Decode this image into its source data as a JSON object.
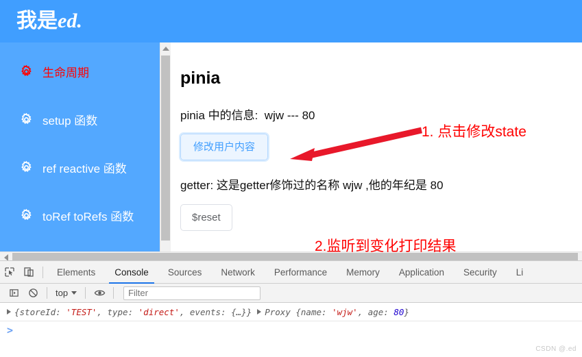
{
  "header": {
    "title_cn": "我是",
    "title_en": "ed."
  },
  "sidebar": {
    "items": [
      {
        "label": "生命周期",
        "icon": "gear-icon",
        "active": true
      },
      {
        "label": "setup 函数",
        "icon": "gear-icon",
        "active": false
      },
      {
        "label": "ref reactive 函数",
        "icon": "gear-icon",
        "active": false
      },
      {
        "label": "toRef toRefs 函数",
        "icon": "gear-icon",
        "active": false
      }
    ]
  },
  "main": {
    "heading": "pinia",
    "info_line": "pinia 中的信息:  wjw --- 80",
    "modify_button": "修改用户内容",
    "getter_line": "getter: 这是getter修饰过的名称 wjw ,他的年纪是 80",
    "reset_button": "$reset"
  },
  "annotations": [
    {
      "text": "1. 点击修改state",
      "color": "#ff0000"
    },
    {
      "text": "2.监听到变化打印结果",
      "color": "#ff0000"
    }
  ],
  "devtools": {
    "tabs": [
      {
        "label": "Elements",
        "active": false
      },
      {
        "label": "Console",
        "active": true
      },
      {
        "label": "Sources",
        "active": false
      },
      {
        "label": "Network",
        "active": false
      },
      {
        "label": "Performance",
        "active": false
      },
      {
        "label": "Memory",
        "active": false
      },
      {
        "label": "Application",
        "active": false
      },
      {
        "label": "Security",
        "active": false
      },
      {
        "label": "Li",
        "active": false
      }
    ],
    "toolbar": {
      "context_label": "top",
      "filter_placeholder": "Filter",
      "filter_value": ""
    },
    "console_rows": [
      {
        "segments": [
          {
            "text": "{storeId: ",
            "style": "gray"
          },
          {
            "text": "'TEST'",
            "style": "red"
          },
          {
            "text": ", type: ",
            "style": "gray"
          },
          {
            "text": "'direct'",
            "style": "red"
          },
          {
            "text": ", events: {…}}",
            "style": "gray"
          }
        ],
        "second": [
          {
            "text": "Proxy {name: ",
            "style": "gray"
          },
          {
            "text": "'wjw'",
            "style": "red"
          },
          {
            "text": ", age: ",
            "style": "gray"
          },
          {
            "text": "80",
            "style": "blue"
          },
          {
            "text": "}",
            "style": "gray"
          }
        ]
      }
    ],
    "prompt": ">"
  },
  "watermark": "CSDN @.ed",
  "colors": {
    "brand_blue": "#409eff",
    "sidebar_blue": "#53a8ff",
    "active_red": "#ff0000",
    "tab_underline": "#1a73e8"
  }
}
